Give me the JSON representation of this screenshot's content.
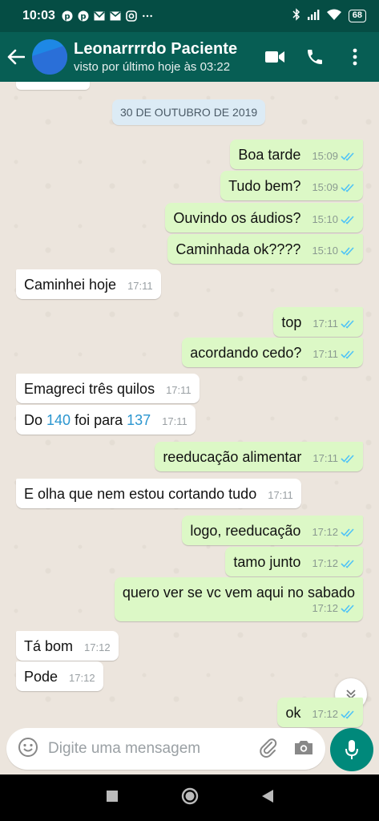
{
  "status_bar": {
    "time": "10:03",
    "battery": "68"
  },
  "app_bar": {
    "contact_name": "Leonarrrrdo Paciente",
    "contact_status": "visto por último hoje às 03:22"
  },
  "chat": {
    "date_label": "30 DE OUTUBRO DE 2019",
    "messages": [
      {
        "text": "Boa tarde",
        "time": "15:09"
      },
      {
        "text": "Tudo bem?",
        "time": "15:09"
      },
      {
        "text": "Ouvindo os áudios?",
        "time": "15:10"
      },
      {
        "text": "Caminhada ok????",
        "time": "15:10"
      },
      {
        "text": "Caminhei hoje",
        "time": "17:11"
      },
      {
        "text": "top",
        "time": "17:11"
      },
      {
        "text": "acordando cedo?",
        "time": "17:11"
      },
      {
        "text": "Emagreci três quilos",
        "time": "17:11"
      },
      {
        "text_before": "Do ",
        "num1": "140",
        "text_mid": " foi para ",
        "num2": "137",
        "time": "17:11"
      },
      {
        "text": "reeducação alimentar",
        "time": "17:11"
      },
      {
        "text": "E olha que nem estou cortando tudo",
        "time": "17:11"
      },
      {
        "text": "logo, reeducação",
        "time": "17:12"
      },
      {
        "text": "tamo junto",
        "time": "17:12"
      },
      {
        "text": "quero ver se vc vem aqui no sabado",
        "time": "17:12"
      },
      {
        "text": "Tá bom",
        "time": "17:12"
      },
      {
        "text": "Pode",
        "time": "17:12"
      },
      {
        "text": "ok",
        "time": "17:12"
      }
    ]
  },
  "composer": {
    "placeholder": "Digite uma mensagem"
  },
  "colors": {
    "header": "#075e54",
    "outgoing": "#dcf8c6",
    "incoming": "#ffffff",
    "read_ticks": "#4fc3f7",
    "mic": "#00897b"
  }
}
